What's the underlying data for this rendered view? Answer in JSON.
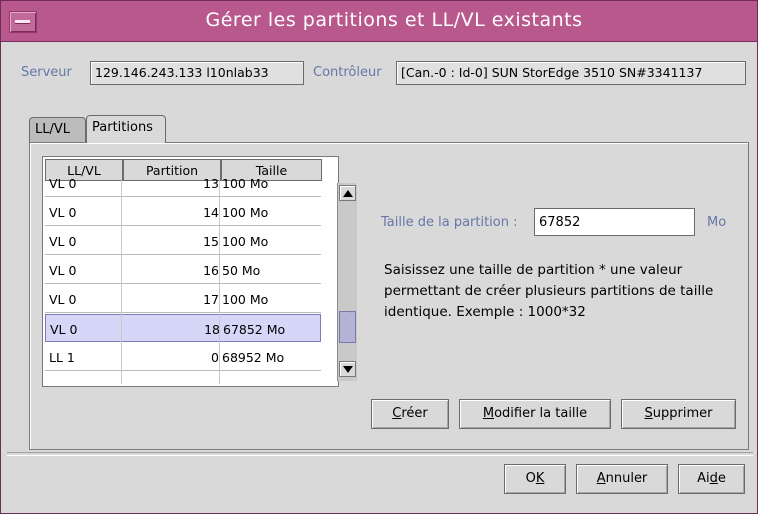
{
  "window": {
    "title": "Gérer les partitions et LL/VL existants",
    "accent_color": "#b8588d"
  },
  "header": {
    "server_label": "Serveur",
    "server_value": "129.146.243.133 l10nlab33",
    "controller_label": "Contrôleur",
    "controller_value": "[Can.-0 : Id-0] SUN StorEdge 3510 SN#3341137"
  },
  "tabs": [
    {
      "label": "LL/VL",
      "active": false
    },
    {
      "label": "Partitions",
      "active": true
    }
  ],
  "table": {
    "columns": [
      "LL/VL",
      "Partition",
      "Taille"
    ],
    "rows": [
      {
        "llvl": "VL 0",
        "partition": "13",
        "size": "100 Mo"
      },
      {
        "llvl": "VL 0",
        "partition": "14",
        "size": "100 Mo"
      },
      {
        "llvl": "VL 0",
        "partition": "15",
        "size": "100 Mo"
      },
      {
        "llvl": "VL 0",
        "partition": "16",
        "size": "50 Mo"
      },
      {
        "llvl": "VL 0",
        "partition": "17",
        "size": "100 Mo"
      },
      {
        "llvl": "VL 0",
        "partition": "18",
        "size": "67852 Mo",
        "selected": true
      },
      {
        "llvl": "LL 1",
        "partition": "0",
        "size": "68952 Mo"
      }
    ]
  },
  "partition_form": {
    "size_label": "Taille de la partition :",
    "size_value": "67852",
    "unit": "Mo",
    "help_text": "Saisissez une taille de partition * une valeur permettant de créer plusieurs partitions de taille identique. Exemple : 1000*32"
  },
  "actions": {
    "create_label": "Créer",
    "create_mnemonic": "C",
    "create_rest": "réer",
    "modify_label": "Modifier la taille",
    "modify_mnemonic": "M",
    "modify_rest": "odifier la taille",
    "delete_label": "Supprimer",
    "delete_mnemonic": "S",
    "delete_rest": "upprimer"
  },
  "footer": {
    "ok_label": "OK",
    "ok_pre": "O",
    "ok_mnemonic": "K",
    "cancel_label": "Annuler",
    "cancel_mnemonic": "A",
    "cancel_rest": "nnuler",
    "help_label": "Aide",
    "help_pre": "Ai",
    "help_mnemonic": "d",
    "help_post": "e"
  }
}
